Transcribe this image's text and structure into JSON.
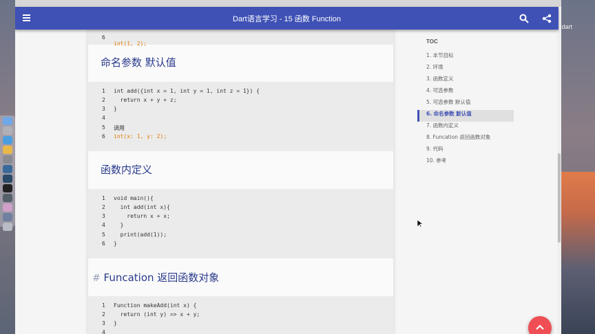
{
  "window": {
    "title": "Dart语言学习 - 15 函数 Function"
  },
  "desktop": {
    "label": "dart"
  },
  "sections": {
    "top_code": [
      {
        "n": "6",
        "t": "int(1, 2);"
      }
    ],
    "named_heading": "命名参数 默认值",
    "named_code": [
      {
        "n": "1",
        "t": "int add({int x = 1, int y = 1, int z = 1}) {"
      },
      {
        "n": "2",
        "t": "  return x + y + z;"
      },
      {
        "n": "3",
        "t": "}"
      },
      {
        "n": "4",
        "t": ""
      },
      {
        "n": "5",
        "t": "调用"
      },
      {
        "n": "6",
        "t": "int(x: 1, y: 2);"
      }
    ],
    "inner_heading": "函数内定义",
    "inner_code": [
      {
        "n": "1",
        "t": "void main(){"
      },
      {
        "n": "2",
        "t": "  int add(int x){"
      },
      {
        "n": "3",
        "t": "    return x + x;"
      },
      {
        "n": "4",
        "t": "  }"
      },
      {
        "n": "5",
        "t": "  print(add(1));"
      },
      {
        "n": "6",
        "t": "}"
      }
    ],
    "func_heading_hash": "#",
    "func_heading": "Funcation 返回函数对象",
    "func_code": [
      {
        "n": "1",
        "t": "Function makeAdd(int x) {"
      },
      {
        "n": "2",
        "t": "  return (int y) => x + y;"
      },
      {
        "n": "3",
        "t": "}"
      },
      {
        "n": "4",
        "t": ""
      }
    ]
  },
  "toc": {
    "title": "TOC",
    "items": [
      "1. 本节目标",
      "2. 环境",
      "3. 函数定义",
      "4. 可选参数",
      "5. 可选参数 默认值",
      "6. 命名参数 默认值",
      "7. 函数内定义",
      "8. Funcation 返回函数对象",
      "9. 代码",
      "10. 参考"
    ],
    "active_index": 5
  },
  "colors": {
    "appbar": "#3f51b5",
    "heading": "#2a3a8c",
    "keyword": "#e07b00",
    "fab": "#ef4e54"
  },
  "icons": [
    "menu-icon",
    "search-icon",
    "share-icon",
    "chevron-up-icon"
  ]
}
